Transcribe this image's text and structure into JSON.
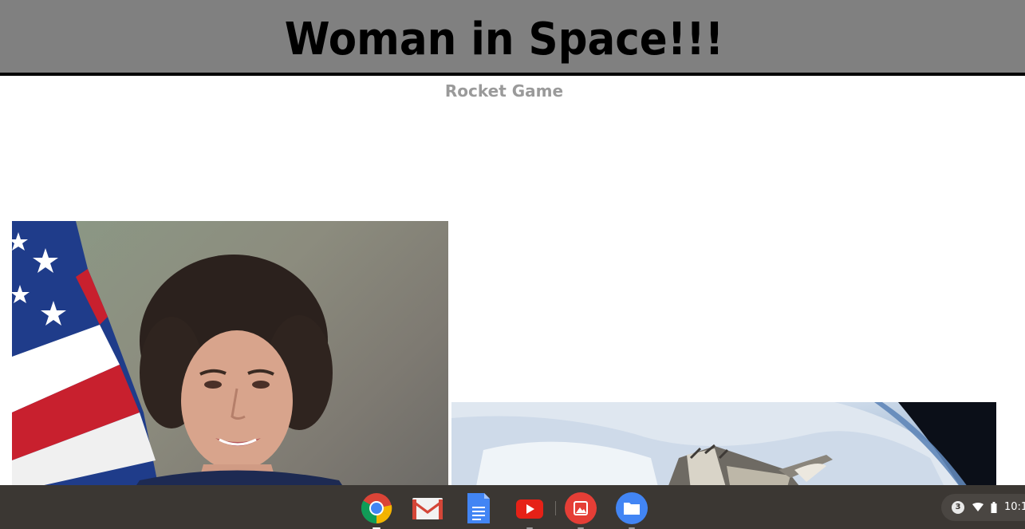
{
  "header": {
    "title": "Woman in Space!!!"
  },
  "nav": {
    "rocket_game_label": "Rocket Game"
  },
  "images": [
    {
      "name": "astronaut-portrait",
      "description_icon": "portrait-photo"
    },
    {
      "name": "space-shuttle-earth",
      "description_icon": "shuttle-photo"
    }
  ],
  "shelf": {
    "apps": [
      {
        "name": "chrome",
        "icon": "chrome-icon",
        "active": true
      },
      {
        "name": "gmail",
        "icon": "gmail-icon",
        "active": false
      },
      {
        "name": "docs",
        "icon": "docs-icon",
        "active": false
      },
      {
        "name": "youtube",
        "icon": "youtube-icon",
        "active": false
      },
      {
        "name": "gallery",
        "icon": "gallery-icon",
        "active": false
      },
      {
        "name": "files",
        "icon": "files-icon",
        "active": false
      }
    ]
  },
  "status": {
    "notification_count": "3",
    "clock": "10:1"
  },
  "colors": {
    "header_bg": "#808080",
    "header_border": "#000000",
    "nav_link": "#9a9a9a",
    "taskbar_bg": "#3b3733"
  }
}
